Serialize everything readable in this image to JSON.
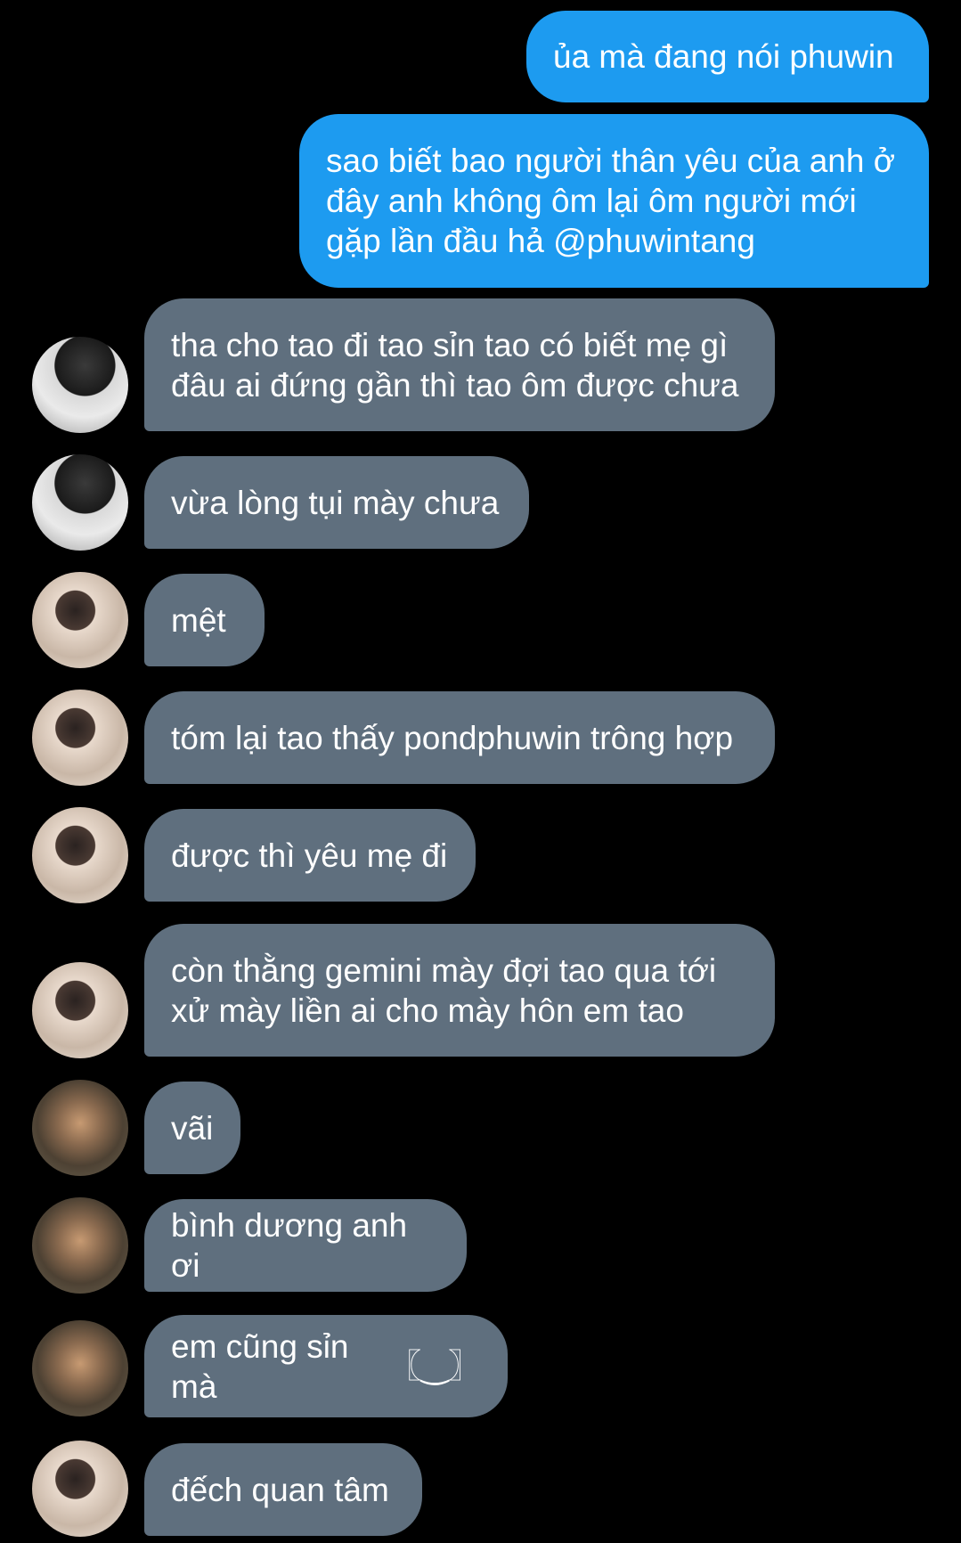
{
  "messages": [
    {
      "side": "sent",
      "text": "ủa mà đang nói phuwin"
    },
    {
      "side": "sent",
      "text": "sao biết bao người thân yêu của anh ở đây anh không ôm lại ôm người mới gặp lần đầu hả @phuwintang"
    },
    {
      "side": "received",
      "avatar": "avatar-black-tank-photo",
      "text": "tha cho tao đi tao sỉn tao có biết mẹ gì đâu ai đứng gần thì tao ôm được chưa"
    },
    {
      "side": "received",
      "avatar": "avatar-black-tank-photo",
      "text": "vừa lòng tụi mày chưa"
    },
    {
      "side": "received",
      "avatar": "avatar-flower-hair-photo",
      "text": "mệt"
    },
    {
      "side": "received",
      "avatar": "avatar-flower-hair-photo",
      "text": "tóm lại tao thấy pondphuwin trông hợp"
    },
    {
      "side": "received",
      "avatar": "avatar-flower-hair-photo",
      "text": "được thì yêu mẹ đi"
    },
    {
      "side": "received",
      "avatar": "avatar-flower-hair-photo",
      "text": "còn thằng gemini mày đợi tao qua tới xử mày liền ai cho mày hôn em tao"
    },
    {
      "side": "received",
      "avatar": "avatar-mirror-selfie-photo",
      "text": "vãi"
    },
    {
      "side": "received",
      "avatar": "avatar-mirror-selfie-photo",
      "text": "bình dương anh ơi"
    },
    {
      "side": "received",
      "avatar": "avatar-mirror-selfie-photo",
      "text": "em cũng sỉn mà",
      "emoji": "〖‿〗"
    },
    {
      "side": "received",
      "avatar": "avatar-flower-hair-photo",
      "text": "đếch quan tâm"
    }
  ],
  "colors": {
    "background": "#000000",
    "sent_bubble": "#1d9bf0",
    "received_bubble": "#5f6f7e",
    "text": "#ffffff"
  }
}
